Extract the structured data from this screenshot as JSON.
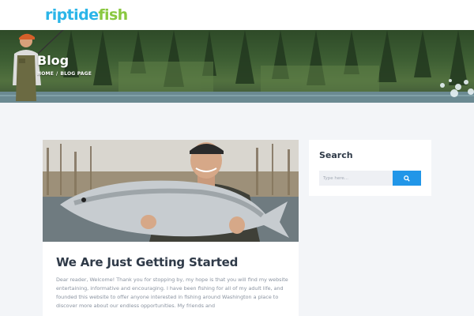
{
  "header": {
    "logo_part1": "riptide",
    "logo_part2": "fish"
  },
  "hero": {
    "title": "Blog",
    "breadcrumb": [
      "HOME",
      "BLOG PAGE"
    ]
  },
  "post": {
    "title": "We Are Just Getting Started",
    "excerpt": "Dear reader, Welcome! Thank you for stopping by, my hope is that you will find my website entertaining, informative and encouraging. I have been fishing for all of my adult life, and founded this website to offer anyone interested in fishing around Washington a place to discover more about our endless opportunities. My friends and"
  },
  "sidebar": {
    "search": {
      "title": "Search",
      "placeholder": "Type here...",
      "button_icon": "search-icon"
    }
  },
  "colors": {
    "logo_blue": "#2bb5e8",
    "logo_green": "#8ac840",
    "accent_button": "#2196e8",
    "page_background": "#f3f5f8",
    "heading_text": "#2f3a48"
  }
}
